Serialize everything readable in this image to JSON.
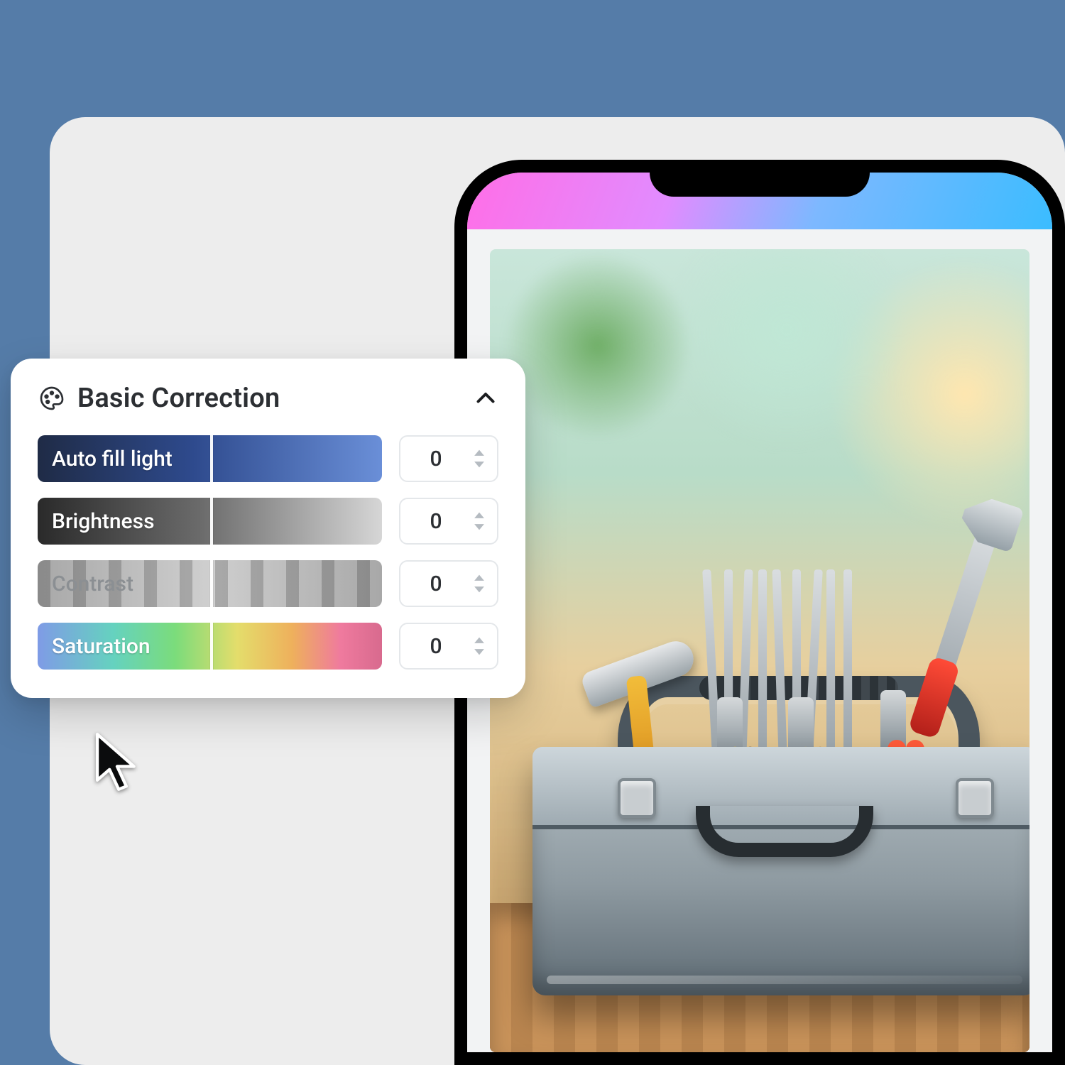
{
  "panel": {
    "title": "Basic Correction",
    "icon": "palette-icon",
    "collapse_icon": "chevron-up-icon",
    "sliders": [
      {
        "id": "auto-fill-light",
        "label": "Auto fill light",
        "value": "0"
      },
      {
        "id": "brightness",
        "label": "Brightness",
        "value": "0"
      },
      {
        "id": "contrast",
        "label": "Contrast",
        "value": "0"
      },
      {
        "id": "saturation",
        "label": "Saturation",
        "value": "0"
      }
    ]
  },
  "phone": {
    "preview_alt": "Toolbox full of hand tools on a wooden workbench"
  }
}
